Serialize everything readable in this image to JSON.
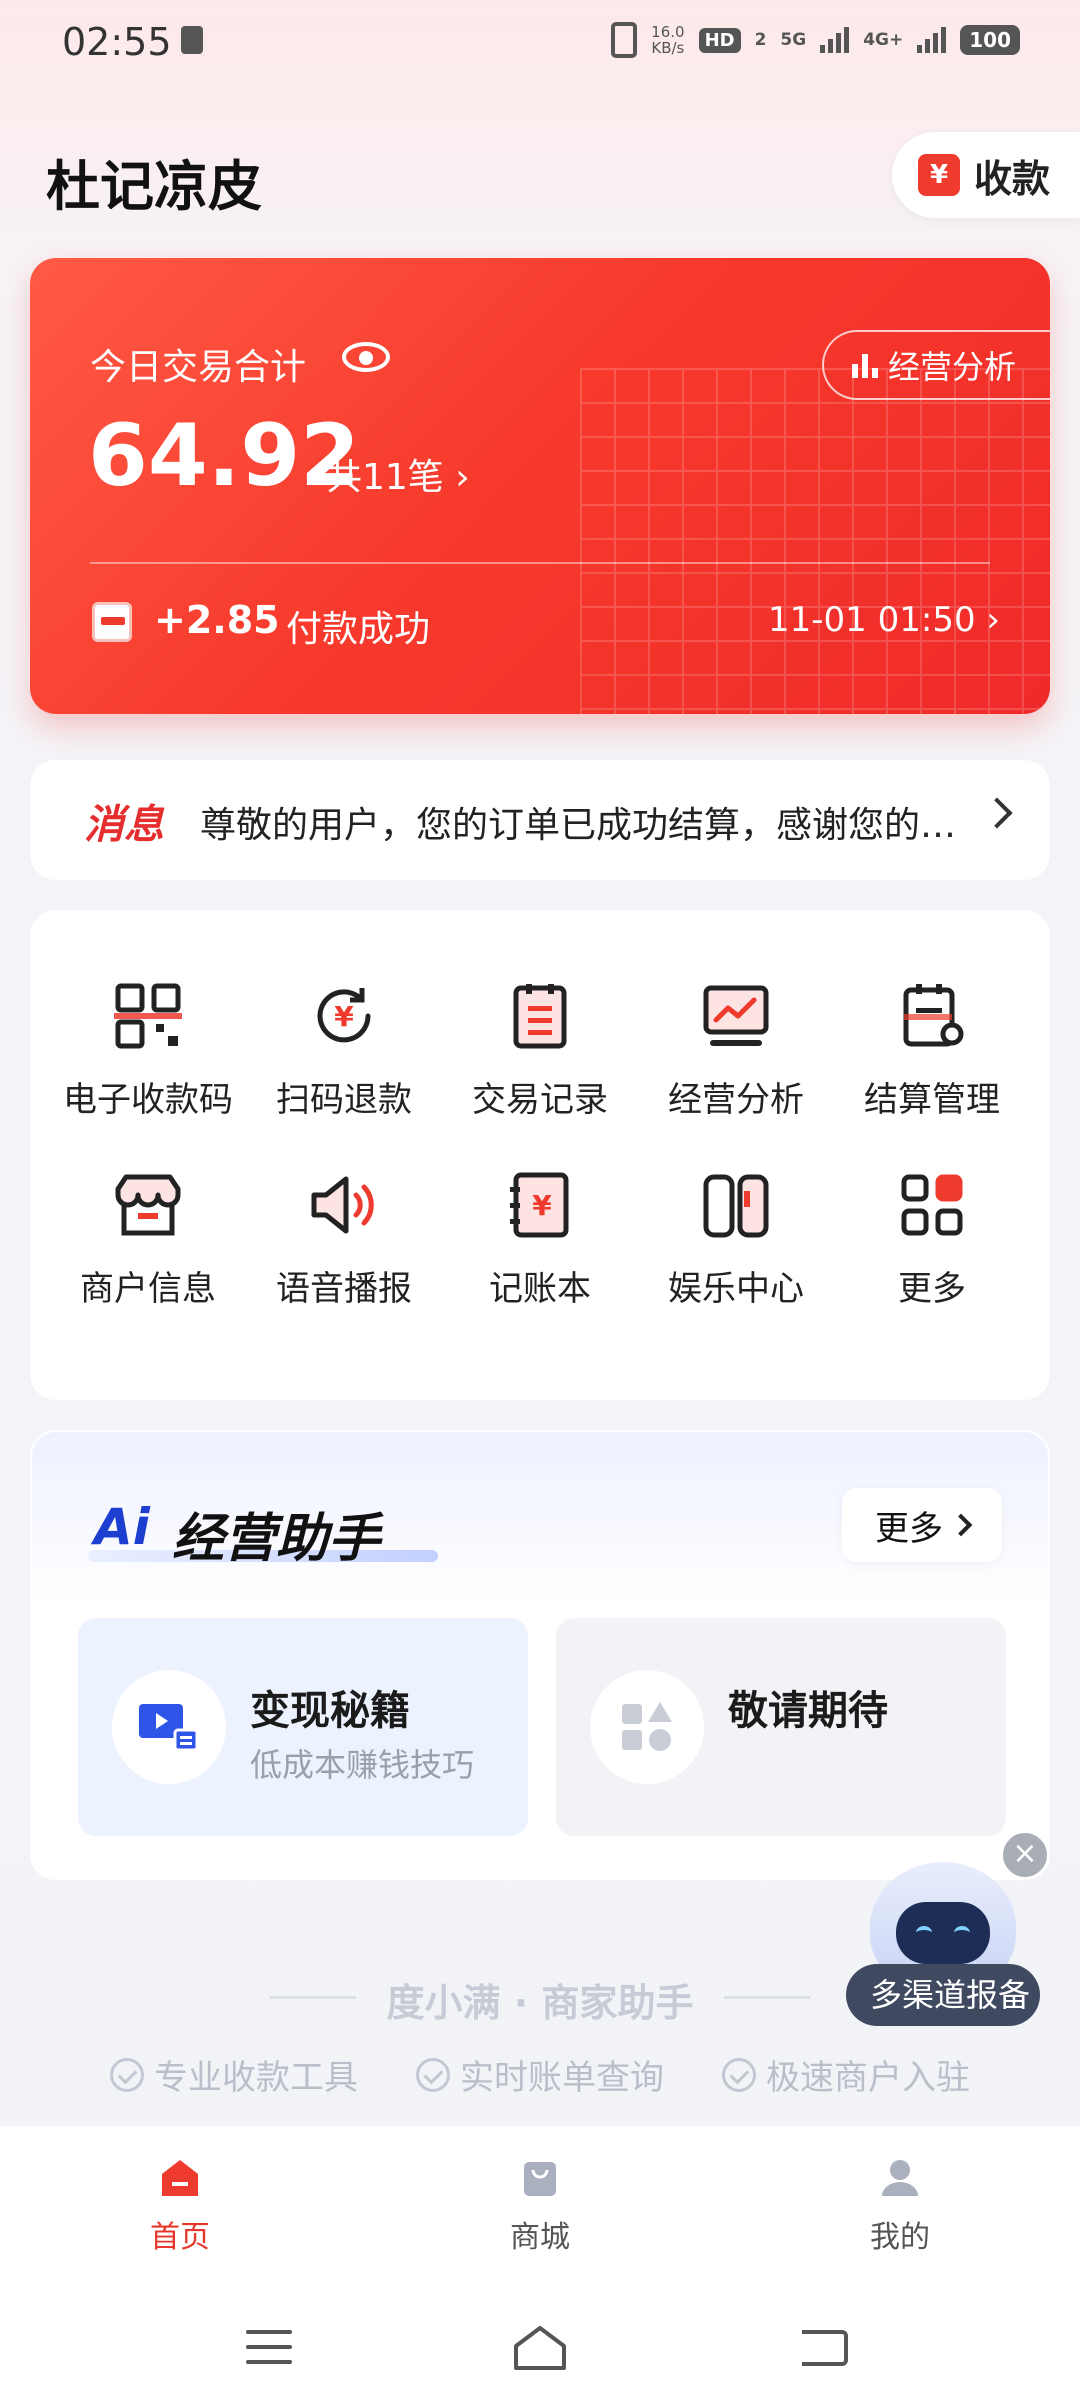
{
  "status_bar": {
    "time": "02:55",
    "net_speed_value": "16.0",
    "net_speed_unit": "KB/s",
    "hd_label": "HD",
    "sim2_label": "2",
    "net_5g": "5G",
    "net_4g": "4G+",
    "battery": "100"
  },
  "header": {
    "title": "杜记凉皮",
    "collect_label": "收款",
    "collect_icon": "yen-icon"
  },
  "summary_card": {
    "label": "今日交易合计",
    "analysis_label": "经营分析",
    "amount": "64.92",
    "count_text": "共11笔 ›",
    "latest_amount": "+2.85",
    "latest_status": "付款成功",
    "latest_time": "11-01 01:50 ›",
    "accent_color": "#f73a2c"
  },
  "message": {
    "tag": "消息",
    "text": "尊敬的用户，您的订单已成功结算，感谢您的使用"
  },
  "functions": [
    {
      "label": "电子收款码",
      "icon": "qr-code-icon"
    },
    {
      "label": "扫码退款",
      "icon": "refund-icon"
    },
    {
      "label": "交易记录",
      "icon": "record-icon"
    },
    {
      "label": "经营分析",
      "icon": "analysis-monitor-icon"
    },
    {
      "label": "结算管理",
      "icon": "settlement-icon"
    },
    {
      "label": "商户信息",
      "icon": "store-icon"
    },
    {
      "label": "语音播报",
      "icon": "speaker-icon"
    },
    {
      "label": "记账本",
      "icon": "ledger-icon"
    },
    {
      "label": "娱乐中心",
      "icon": "gamepad-icon"
    },
    {
      "label": "更多",
      "icon": "apps-icon"
    }
  ],
  "ai_assistant": {
    "logo": "Ai",
    "title": "经营助手",
    "more_label": "更多",
    "tiles": [
      {
        "title": "变现秘籍",
        "subtitle": "低成本赚钱技巧",
        "icon": "video-icon"
      },
      {
        "title": "敬请期待",
        "subtitle": "",
        "icon": "shapes-icon"
      }
    ]
  },
  "footer_brand": {
    "name": "度小满 · 商家助手",
    "features": [
      "专业收款工具",
      "实时账单查询",
      "极速商户入驻"
    ]
  },
  "floating_bot": {
    "bubble": "多渠道报备"
  },
  "tab_bar": {
    "tabs": [
      {
        "label": "首页",
        "icon": "home-icon",
        "active": true
      },
      {
        "label": "商城",
        "icon": "shop-bag-icon",
        "active": false
      },
      {
        "label": "我的",
        "icon": "profile-icon",
        "active": false
      }
    ]
  }
}
